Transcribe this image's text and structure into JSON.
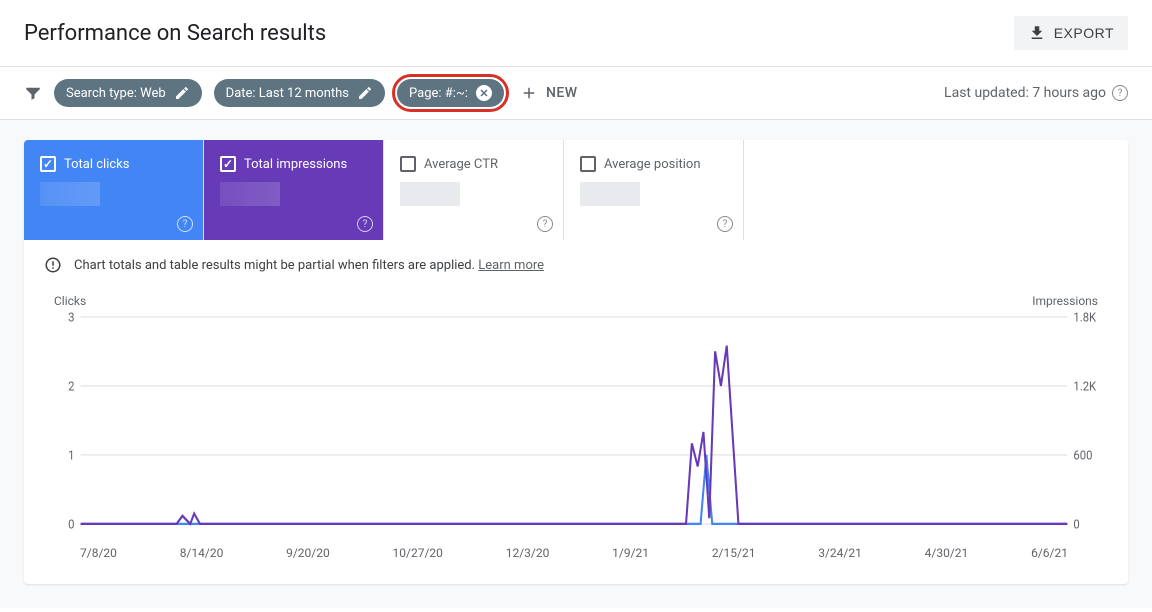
{
  "header": {
    "title": "Performance on Search results",
    "export_label": "EXPORT"
  },
  "filters": {
    "search_type": "Search type: Web",
    "date": "Date: Last 12 months",
    "page": "Page: #:~:",
    "new_label": "NEW",
    "last_updated": "Last updated: 7 hours ago"
  },
  "metrics": {
    "clicks_label": "Total clicks",
    "impressions_label": "Total impressions",
    "ctr_label": "Average CTR",
    "position_label": "Average position"
  },
  "info_bar": {
    "text": "Chart totals and table results might be partial when filters are applied.",
    "learn_more": "Learn more"
  },
  "chart_data": {
    "type": "line",
    "xlabel": "",
    "left_axis_title": "Clicks",
    "right_axis_title": "Impressions",
    "y_left": {
      "ticks": [
        0,
        1,
        2,
        3
      ],
      "range": [
        0,
        3
      ]
    },
    "y_right": {
      "ticks": [
        "0",
        "600",
        "1.2K",
        "1.8K"
      ],
      "range": [
        0,
        1800
      ]
    },
    "x_ticks": [
      "7/8/20",
      "8/14/20",
      "9/20/20",
      "10/27/20",
      "12/3/20",
      "1/9/21",
      "2/15/21",
      "3/24/21",
      "4/30/21",
      "6/6/21"
    ],
    "series": [
      {
        "name": "Clicks",
        "color": "#4285f4",
        "points": [
          {
            "x": "7/8/20",
            "y": 0
          },
          {
            "x": "8/14/20",
            "y": 0
          },
          {
            "x": "9/20/20",
            "y": 0
          },
          {
            "x": "10/27/20",
            "y": 0
          },
          {
            "x": "12/3/20",
            "y": 0
          },
          {
            "x": "1/9/21",
            "y": 0
          },
          {
            "x": "2/4/21",
            "y": 0
          },
          {
            "x": "2/6/21",
            "y": 1
          },
          {
            "x": "2/8/21",
            "y": 0
          },
          {
            "x": "6/6/21",
            "y": 0
          }
        ]
      },
      {
        "name": "Impressions",
        "color": "#673ab7",
        "points": [
          {
            "x": "7/8/20",
            "y": 0
          },
          {
            "x": "8/10/20",
            "y": 0
          },
          {
            "x": "8/12/20",
            "y": 70
          },
          {
            "x": "8/14/20",
            "y": 0
          },
          {
            "x": "8/16/20",
            "y": 90
          },
          {
            "x": "8/18/20",
            "y": 0
          },
          {
            "x": "1/30/21",
            "y": 0
          },
          {
            "x": "2/1/21",
            "y": 700
          },
          {
            "x": "2/3/21",
            "y": 500
          },
          {
            "x": "2/5/21",
            "y": 800
          },
          {
            "x": "2/7/21",
            "y": 50
          },
          {
            "x": "2/9/21",
            "y": 1500
          },
          {
            "x": "2/11/21",
            "y": 1200
          },
          {
            "x": "2/13/21",
            "y": 1550
          },
          {
            "x": "2/15/21",
            "y": 0
          },
          {
            "x": "6/6/21",
            "y": 0
          }
        ]
      }
    ]
  }
}
